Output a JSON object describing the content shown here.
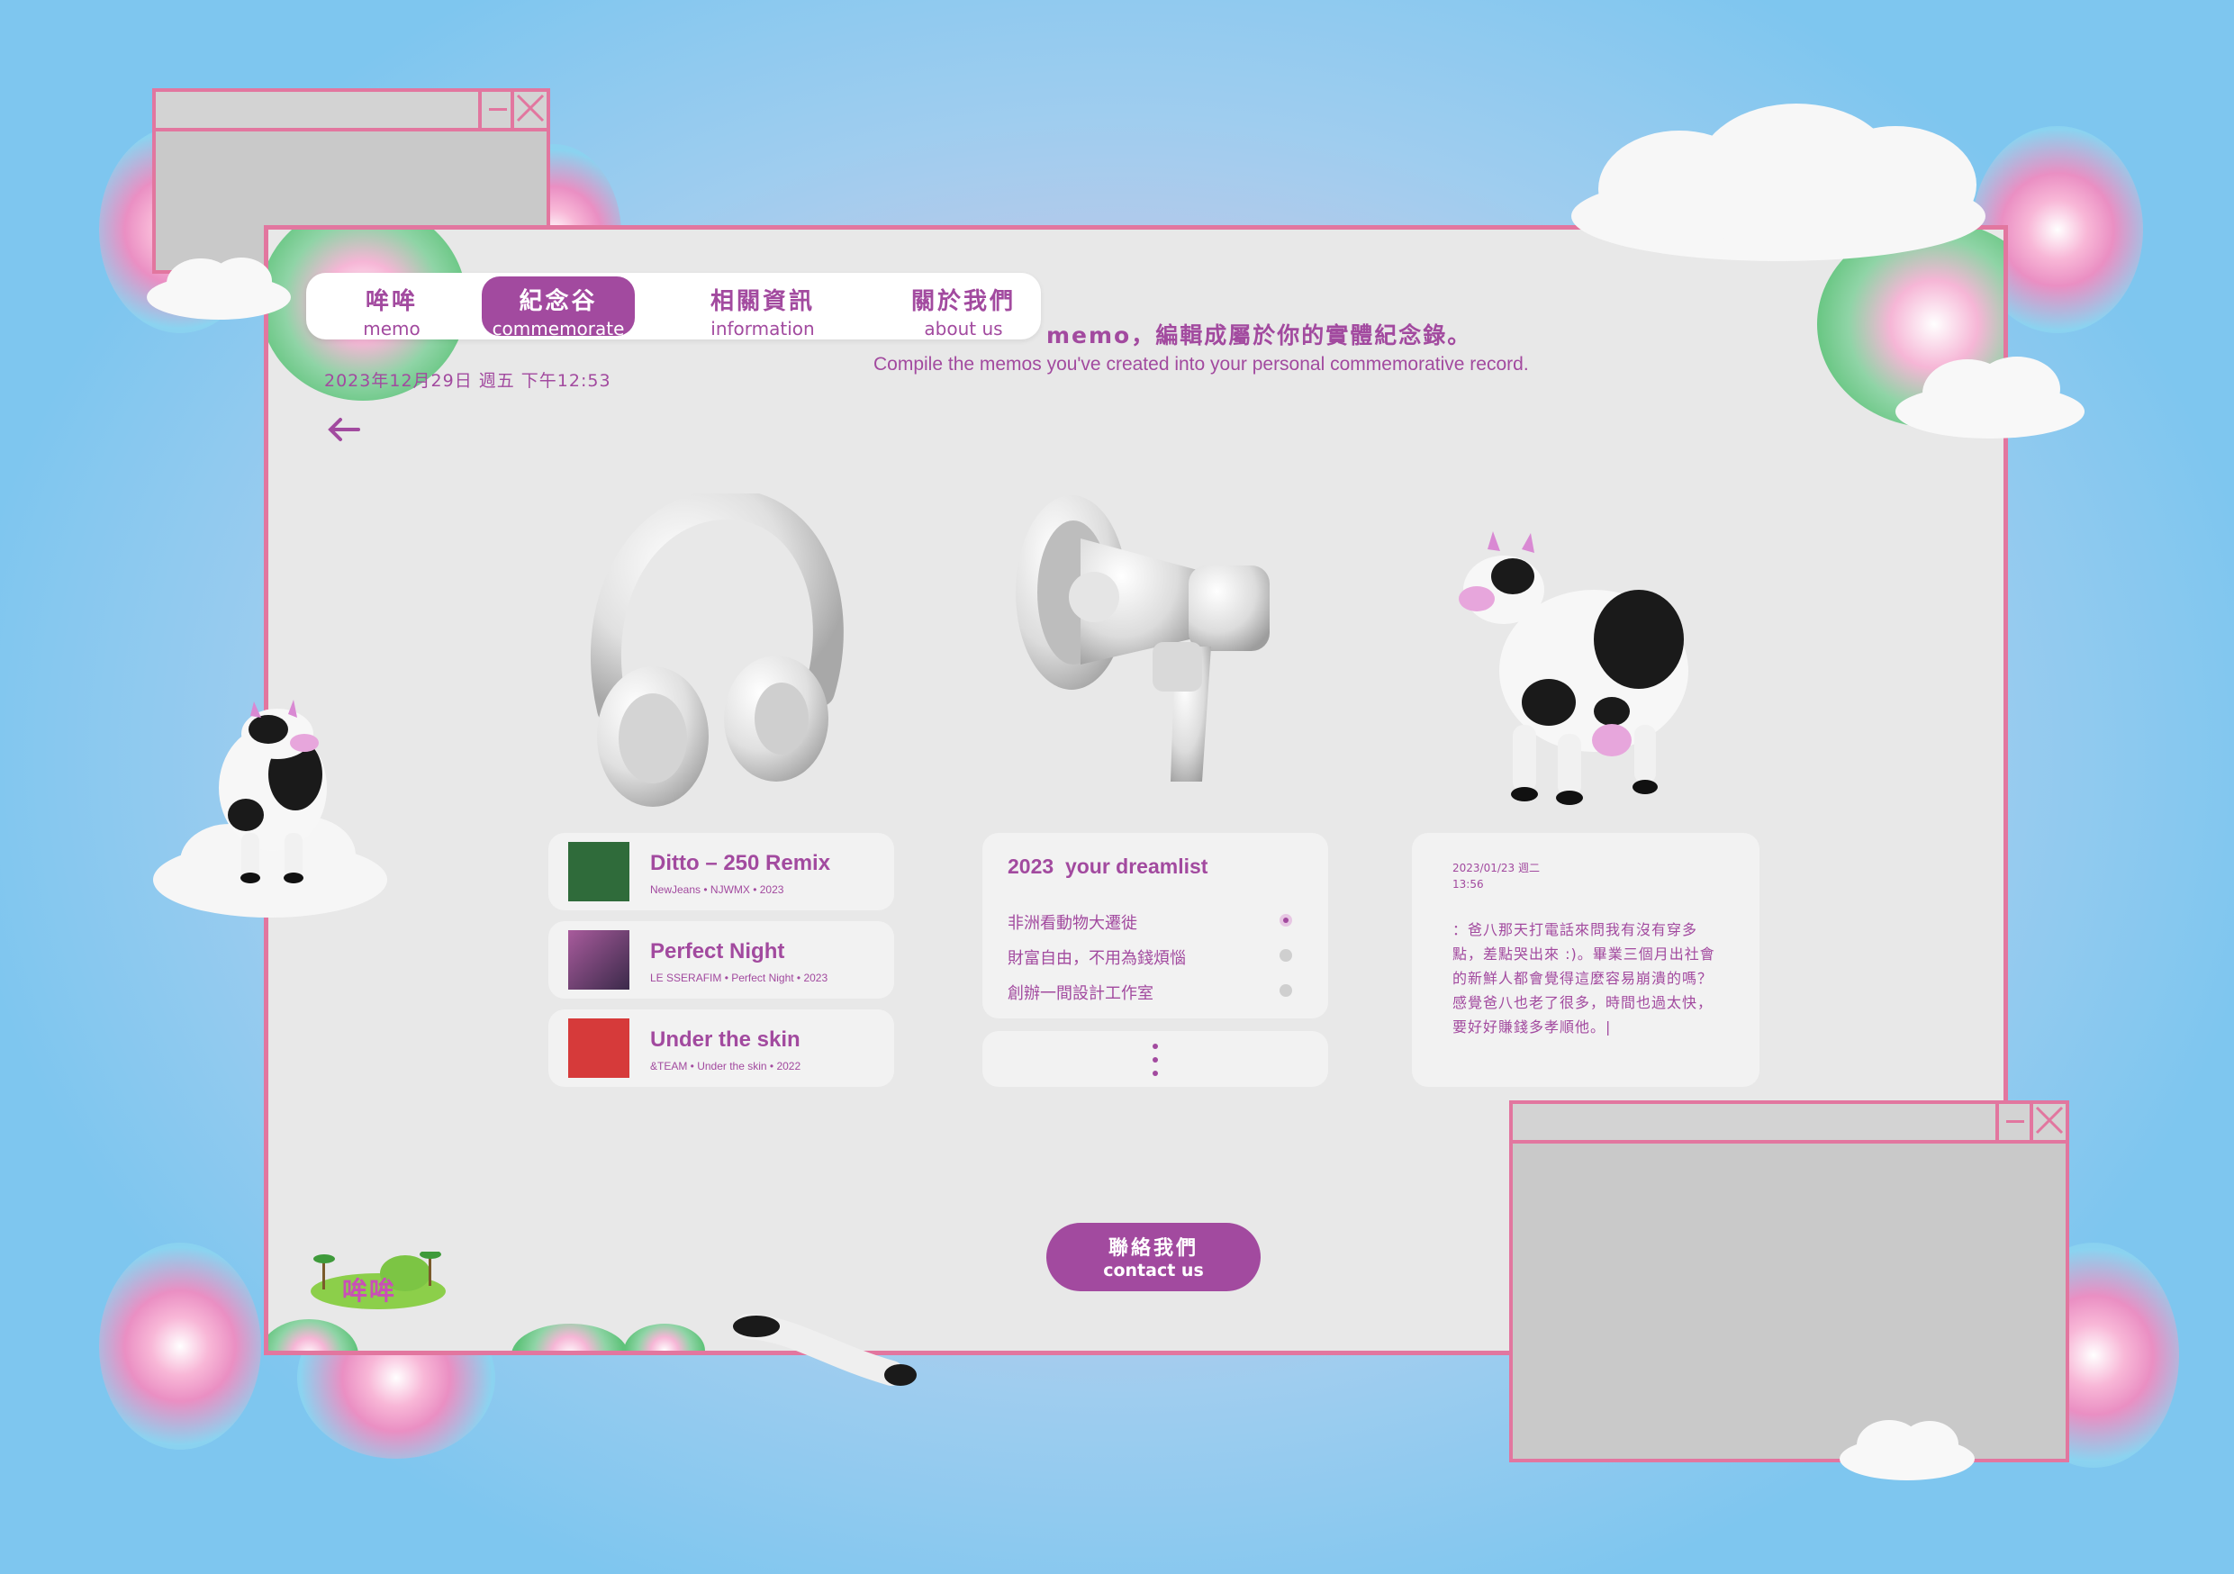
{
  "nav": {
    "items": [
      {
        "zh": "哞哞",
        "en": "memo"
      },
      {
        "zh": "紀念谷",
        "en": "commemorate"
      },
      {
        "zh": "相關資訊",
        "en": "information"
      },
      {
        "zh": "關於我們",
        "en": "about us"
      }
    ],
    "active_index": 1
  },
  "header": {
    "datetime": "2023年12月29日 週五 下午12:53",
    "subtitle_zh": "memo，編輯成屬於你的實體紀念錄。",
    "subtitle_en": "Compile the memos you've created into your personal commemorative record.",
    "back_icon": "arrow-left-icon"
  },
  "songs": [
    {
      "title": "Ditto – 250 Remix",
      "meta": "NewJeans • NJWMX • 2023",
      "cover_color": "#2f6b3a"
    },
    {
      "title": "Perfect Night",
      "meta": "LE SSERAFIM • Perfect Night • 2023",
      "cover_color": "#6a3b6e"
    },
    {
      "title": "Under the skin",
      "meta": "&TEAM • Under the skin • 2022",
      "cover_color": "#d63a3a"
    }
  ],
  "dreamlist": {
    "title": "2023  your dreamlist",
    "items": [
      "非洲看動物大遷徙",
      "財富自由，不用為錢煩惱",
      "創辦一間設計工作室"
    ],
    "more_icon": "vertical-dots-icon"
  },
  "diary": {
    "date": "2023/01/23 週二",
    "time": "13:56",
    "text": "：爸八那天打電話來問我有沒有穿多點，差點哭出來 :)。畢業三個月出社會的新鮮人都會覺得這麼容易崩潰的嗎？感覺爸八也老了很多，時間也過太快，要好好賺錢多孝順他。|"
  },
  "contact": {
    "zh": "聯絡我們",
    "en": "contact us"
  },
  "logo": {
    "text": "哞哞"
  },
  "colors": {
    "accent": "#a24a9f",
    "frame": "#e2769f",
    "panel": "#e8e8e8"
  }
}
